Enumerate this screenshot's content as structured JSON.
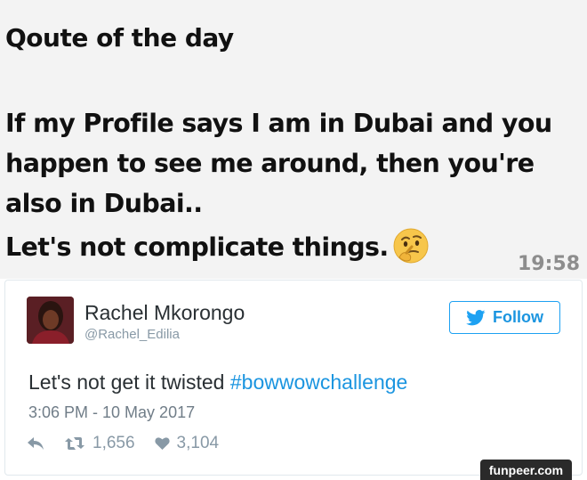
{
  "message": {
    "title": "Qoute of the day",
    "lines": [
      "If my Profile says I am in Dubai and you",
      "happen to see me around, then you're",
      "also in Dubai.."
    ],
    "last_line": "Let's not complicate things.",
    "emoji_icon": "thinking-face-icon",
    "time": "19:58"
  },
  "tweet": {
    "author_name": "Rachel Mkorongo",
    "author_handle": "@Rachel_Edilia",
    "follow_label": "Follow",
    "text": "Let's not get it twisted ",
    "hashtag": "#bowwowchallenge",
    "timestamp": "3:06 PM - 10 May 2017",
    "retweets": "1,656",
    "likes": "3,104"
  },
  "colors": {
    "twitter_blue": "#1da1f2",
    "link_blue": "#1b95e0",
    "muted_gray": "#8899a6",
    "message_bg": "#f3f3f3"
  },
  "watermark": "funpeer.com"
}
